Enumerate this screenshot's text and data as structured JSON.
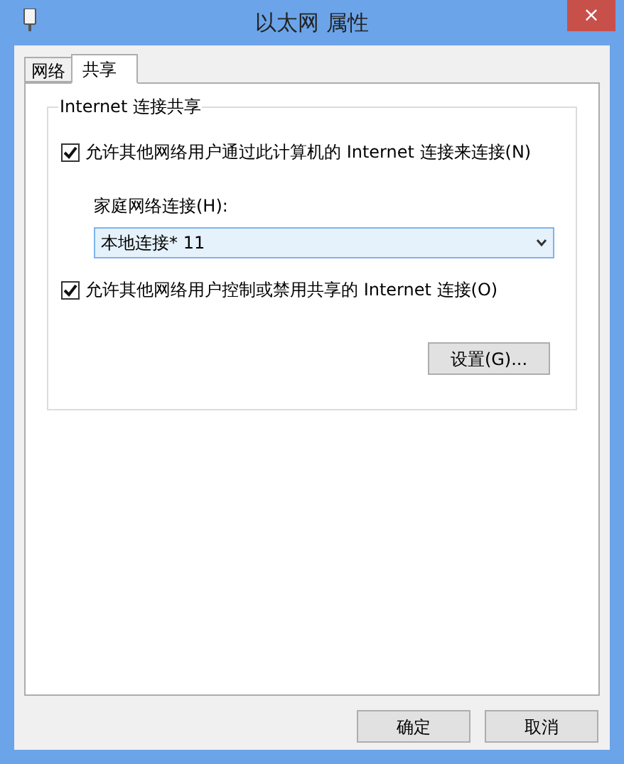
{
  "window": {
    "title": "以太网 属性",
    "close": "×"
  },
  "tabs": [
    {
      "label": "网络",
      "selected": false
    },
    {
      "label": "共享",
      "selected": true
    }
  ],
  "group": {
    "title": "Internet 连接共享",
    "options": [
      {
        "label": "允许其他网络用户通过此计算机的 Internet 连接来连接(N)",
        "checked": true
      }
    ],
    "home_network": {
      "label": "家庭网络连接(H):",
      "value": "本地连接* 11"
    },
    "options_2": [
      {
        "label": "允许其他网络用户控制或禁用共享的 Internet 连接(O)",
        "checked": true
      }
    ],
    "settings_button": "设置(G)..."
  },
  "buttons": [
    "确定",
    "取消"
  ]
}
